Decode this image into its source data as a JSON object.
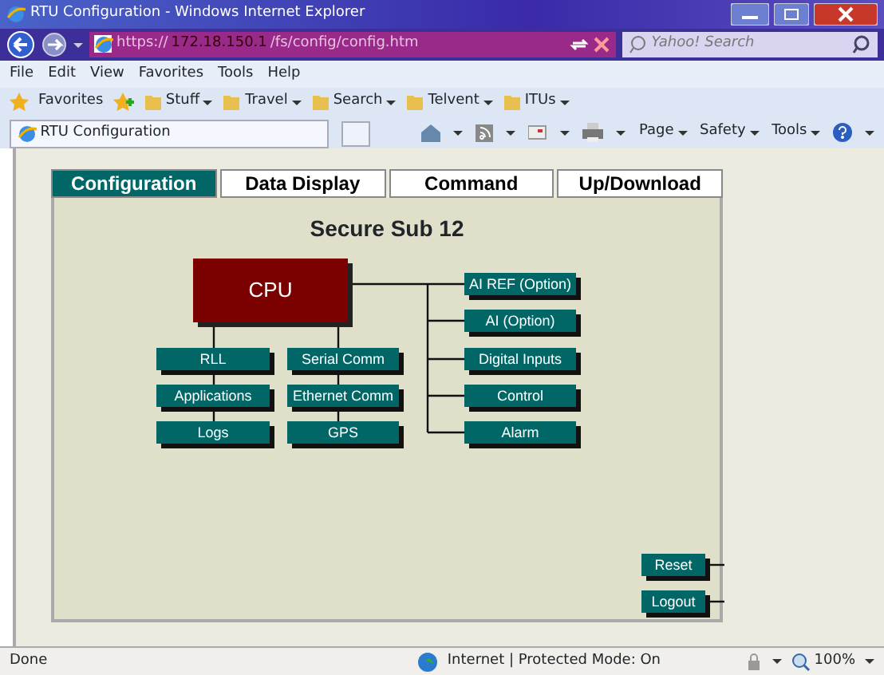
{
  "window": {
    "title": "RTU Configuration - Windows Internet Explorer"
  },
  "address": {
    "scheme": "https://",
    "host": "172.18.150.1",
    "path": "/fs/config/config.htm"
  },
  "search": {
    "placeholder": "Yahoo! Search"
  },
  "menu": [
    "File",
    "Edit",
    "View",
    "Favorites",
    "Tools",
    "Help"
  ],
  "favorites_bar": {
    "label": "Favorites",
    "folders": [
      "Stuff",
      "Travel",
      "Search",
      "Telvent",
      "ITUs"
    ]
  },
  "browser_tab": {
    "title": "RTU Configuration"
  },
  "command_bar": [
    "Page",
    "Safety",
    "Tools"
  ],
  "page_tabs": [
    {
      "label": "Configuration",
      "selected": true
    },
    {
      "label": "Data Display",
      "selected": false
    },
    {
      "label": "Command",
      "selected": false
    },
    {
      "label": "Up/Download",
      "selected": false
    }
  ],
  "heading": "Secure Sub 12",
  "cpu": "CPU",
  "left_modules": [
    "RLL",
    "Applications",
    "Logs"
  ],
  "middle_modules": [
    "Serial Comm",
    "Ethernet Comm",
    "GPS"
  ],
  "right_modules": [
    "AI REF (Option)",
    "AI (Option)",
    "Digital Inputs",
    "Control",
    "Alarm"
  ],
  "actions": [
    "Reset",
    "Logout"
  ],
  "status_bar": {
    "text": "Done",
    "zone": "Internet | Protected Mode: On",
    "zoom": "100%"
  }
}
